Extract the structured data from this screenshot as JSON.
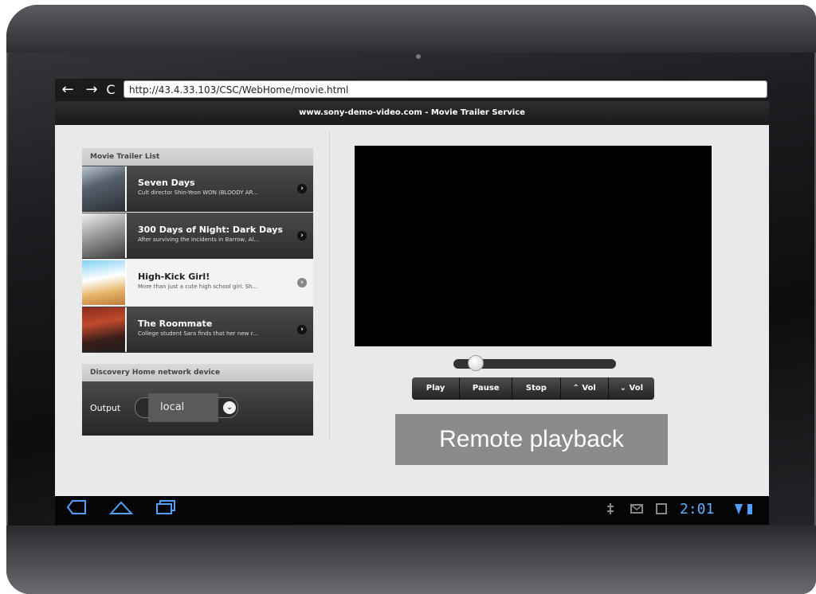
{
  "browser": {
    "url": "http://43.4.33.103/CSC/WebHome/movie.html",
    "back_glyph": "←",
    "forward_glyph": "→",
    "reload_glyph": "C",
    "page_title": "www.sony-demo-video.com - Movie Trailer Service"
  },
  "trailer_list": {
    "header": "Movie Trailer List",
    "items": [
      {
        "title": "Seven Days",
        "desc": "Cult director Shin-Yeon WON (BLOODY AR...",
        "selected": false
      },
      {
        "title": "300 Days of Night: Dark Days",
        "desc": "After surviving the incidents in Barrow, Al...",
        "selected": false
      },
      {
        "title": "High-Kick Girl!",
        "desc": "More than just a cute high school girl. Sh...",
        "selected": true
      },
      {
        "title": "The Roommate",
        "desc": "College student Sara finds that her new r...",
        "selected": false
      }
    ]
  },
  "discovery": {
    "header": "Discovery Home network device",
    "output_label": "Output",
    "output_value": "local"
  },
  "player": {
    "progress": 0.1,
    "buttons": {
      "play": "Play",
      "pause": "Pause",
      "stop": "Stop",
      "vol_up": "⌃ Vol",
      "vol_down": "⌄ Vol"
    },
    "remote_label": "Remote playback"
  },
  "system_bar": {
    "clock": "2:01"
  },
  "colors": {
    "accent": "#5fb0ff",
    "remote_bg": "#8b8b8b"
  },
  "icons": [
    "back-icon",
    "home-icon",
    "recent-apps-icon",
    "usb-icon",
    "mail-icon",
    "calendar-icon",
    "wifi-icon",
    "battery-icon"
  ]
}
